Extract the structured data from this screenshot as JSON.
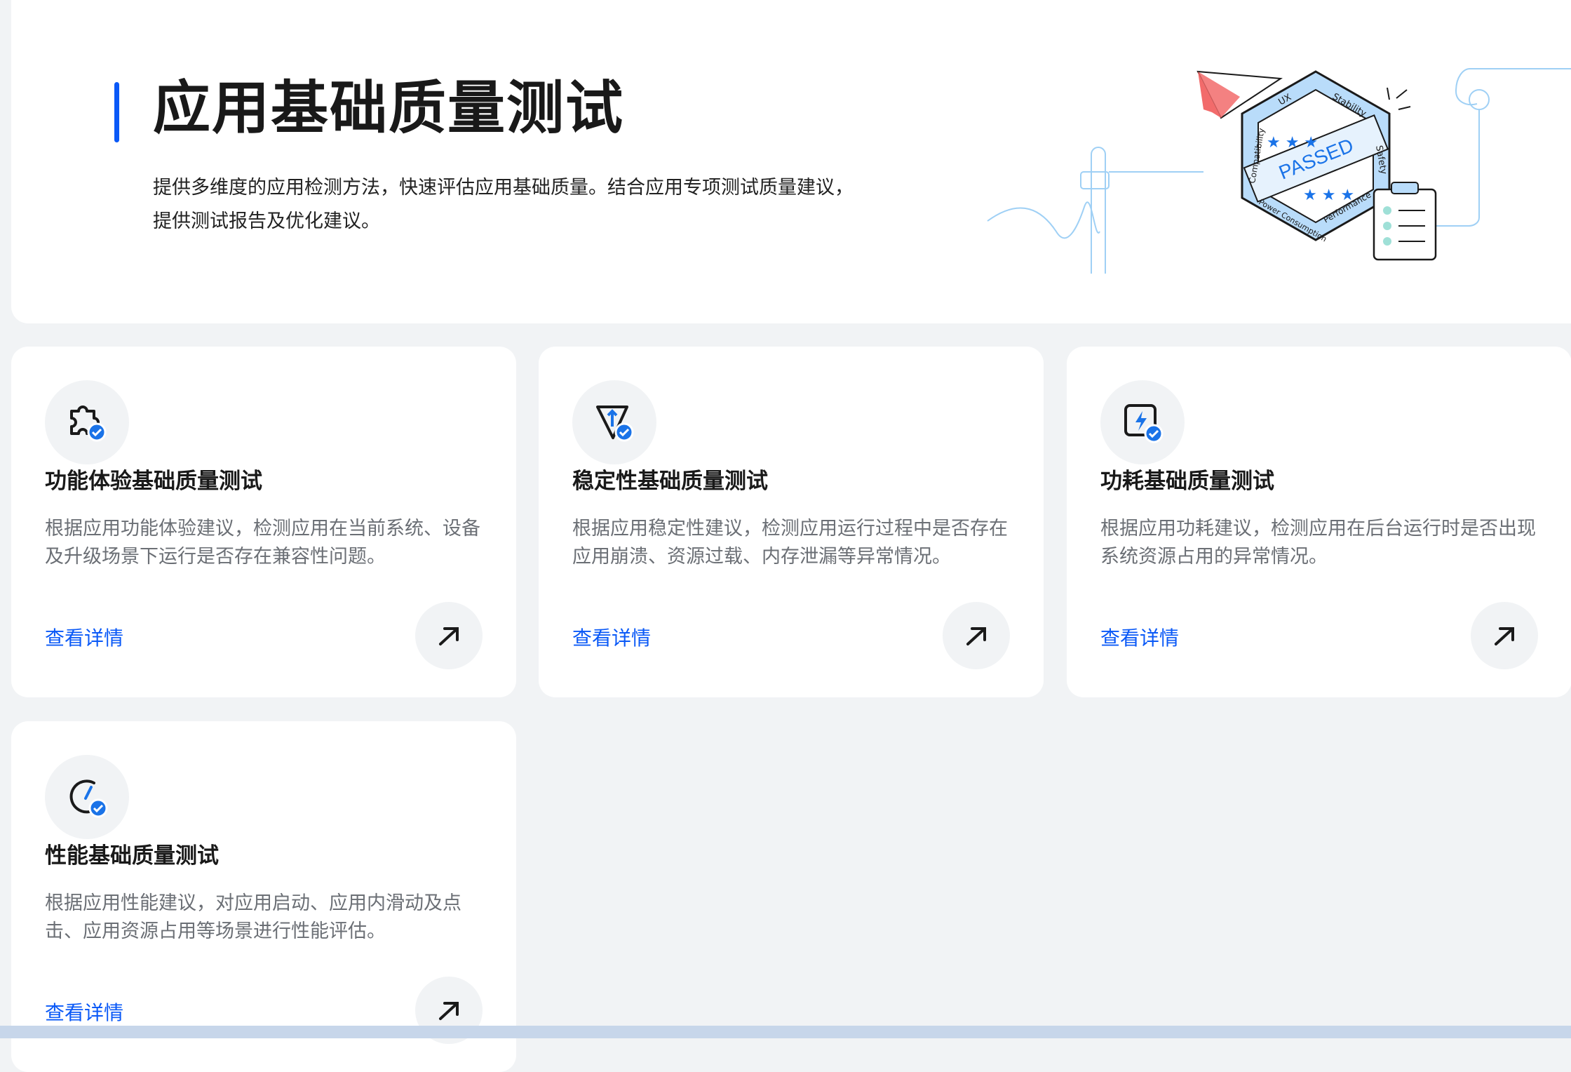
{
  "header": {
    "title": "应用基础质量测试",
    "description": "提供多维度的应用检测方法，快速评估应用基础质量。结合应用专项测试质量建议，提供测试报告及优化建议。",
    "badge": {
      "center_text": "PASSED",
      "labels": [
        "UX",
        "Stability",
        "Safety",
        "Performance",
        "Power Consumption",
        "Compatibility"
      ]
    }
  },
  "cards": [
    {
      "icon": "puzzle-check-icon",
      "title": "功能体验基础质量测试",
      "description": "根据应用功能体验建议，检测应用在当前系统、设备及升级场景下运行是否存在兼容性问题。",
      "link": "查看详情"
    },
    {
      "icon": "funnel-up-check-icon",
      "title": "稳定性基础质量测试",
      "description": "根据应用稳定性建议，检测应用运行过程中是否存在应用崩溃、资源过载、内存泄漏等异常情况。",
      "link": "查看详情"
    },
    {
      "icon": "power-bolt-check-icon",
      "title": "功耗基础质量测试",
      "description": "根据应用功耗建议，检测应用在后台运行时是否出现系统资源占用的异常情况。",
      "link": "查看详情"
    },
    {
      "icon": "speedometer-check-icon",
      "title": "性能基础质量测试",
      "description": "根据应用性能建议，对应用启动、应用内滑动及点击、应用资源占用等场景进行性能评估。",
      "link": "查看详情"
    }
  ],
  "colors": {
    "accent": "#0a59f7",
    "page_bg": "#f1f3f5",
    "card_bg": "#ffffff",
    "badge_light": "#b9dcfa",
    "plane": "#f26b6b"
  }
}
